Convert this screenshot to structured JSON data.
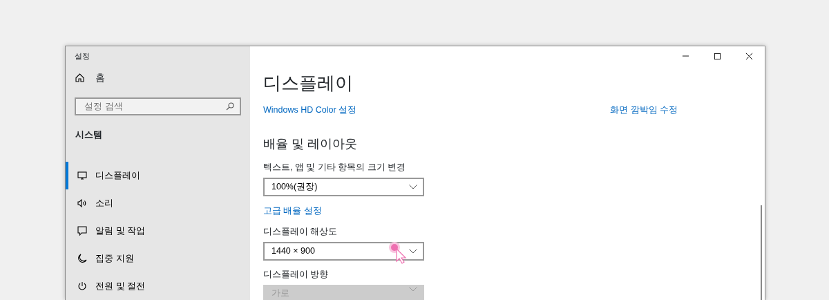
{
  "window": {
    "title": "설정"
  },
  "sidebar": {
    "home": {
      "label": "홈"
    },
    "search": {
      "placeholder": "설정 검색"
    },
    "section": "시스템",
    "items": [
      {
        "label": "디스플레이",
        "selected": true
      },
      {
        "label": "소리",
        "selected": false
      },
      {
        "label": "알림 및 작업",
        "selected": false
      },
      {
        "label": "집중 지원",
        "selected": false
      },
      {
        "label": "전원 및 절전",
        "selected": false
      }
    ]
  },
  "main": {
    "title": "디스플레이",
    "links": [
      "Windows HD Color 설정",
      "화면 깜박임 수정"
    ],
    "section_title": "배율 및 레이아웃",
    "settings": [
      {
        "kind": "dropdown",
        "label": "텍스트, 앱 및 기타 항목의 크기 변경",
        "value": "100%(권장)",
        "disabled": false
      },
      {
        "kind": "link",
        "text": "고급 배율 설정"
      },
      {
        "kind": "dropdown",
        "label": "디스플레이 해상도",
        "value": "1440 × 900",
        "disabled": false,
        "clicked": true
      },
      {
        "kind": "dropdown",
        "label": "디스플레이 방향",
        "value": "가로",
        "disabled": true
      }
    ]
  }
}
